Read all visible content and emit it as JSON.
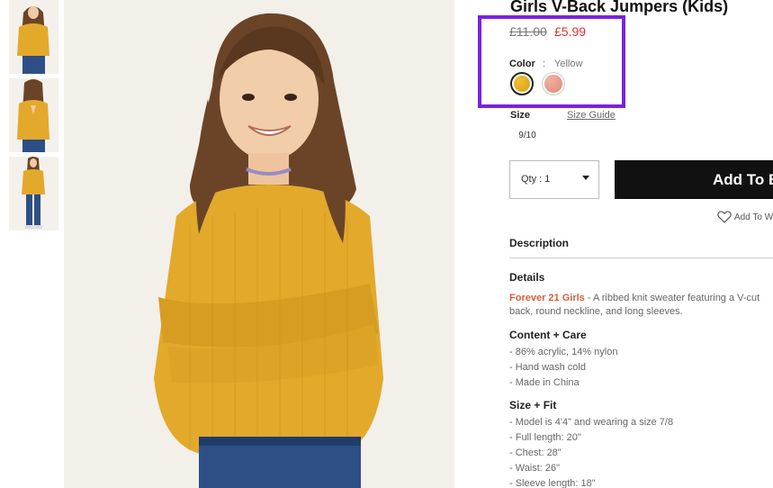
{
  "product": {
    "title": "Girls V-Back Jumpers (Kids)",
    "price_original": "£11.00",
    "price_sale": "£5.99"
  },
  "color": {
    "label": "Color",
    "separator": ":",
    "selected": "Yellow",
    "swatches": [
      "yellow",
      "pink"
    ]
  },
  "size": {
    "label": "Size",
    "guide_link": "Size Guide",
    "option": "9/10"
  },
  "quantity": {
    "label": "Qty : 1"
  },
  "add_to_bag": "Add To Bag",
  "wishlist": "Add To Wishlist",
  "description_heading": "Description",
  "details": {
    "heading": "Details",
    "brand": "Forever 21 Girls",
    "text": " - A ribbed knit sweater featuring a V-cut back, round neckline, and long sleeves."
  },
  "content_care": {
    "heading": "Content + Care",
    "items": [
      "- 86% acrylic, 14% nylon",
      "- Hand wash cold",
      "- Made in China"
    ]
  },
  "size_fit": {
    "heading": "Size + Fit",
    "items": [
      "- Model is 4'4\" and wearing a size 7/8",
      "- Full length: 20\"",
      "- Chest: 28\"",
      "- Waist: 26\"",
      "- Sleeve length: 18\""
    ]
  },
  "colors": {
    "sweater": "#e3a92b",
    "price_sale": "#e2302b",
    "highlight": "#7a22e0",
    "brand_link": "#d2613a"
  }
}
